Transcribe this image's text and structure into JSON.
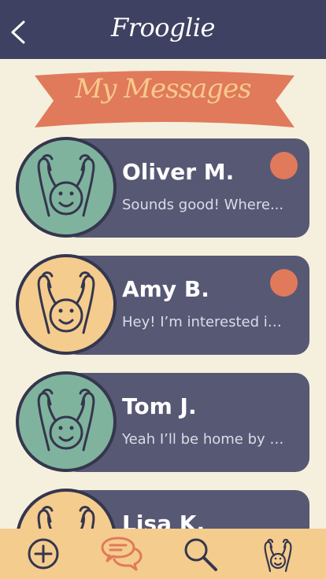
{
  "header": {
    "app_title": "Frooglie",
    "back_icon": "chevron-left-icon"
  },
  "banner": {
    "title": "My Messages"
  },
  "messages": [
    {
      "name": "Oliver M.",
      "preview": "Sounds good!  Where...",
      "avatar_color": "green",
      "unread": true
    },
    {
      "name": "Amy B.",
      "preview": "Hey! I’m interested in...",
      "avatar_color": "yellow",
      "unread": true
    },
    {
      "name": "Tom J.",
      "preview": "Yeah I’ll be home by a...",
      "avatar_color": "green",
      "unread": false
    },
    {
      "name": "Lisa K.",
      "preview": "",
      "avatar_color": "yellow",
      "unread": false
    }
  ],
  "bottom_nav": {
    "items": [
      "add-icon",
      "messages-icon",
      "search-icon",
      "profile-icon"
    ],
    "active": "messages-icon"
  },
  "colors": {
    "header_bg": "#3e4161",
    "page_bg": "#f5f0dd",
    "card_bg": "#575874",
    "accent": "#e07a5b",
    "avatar_green": "#7fb39d",
    "avatar_yellow": "#f4cc8e"
  }
}
